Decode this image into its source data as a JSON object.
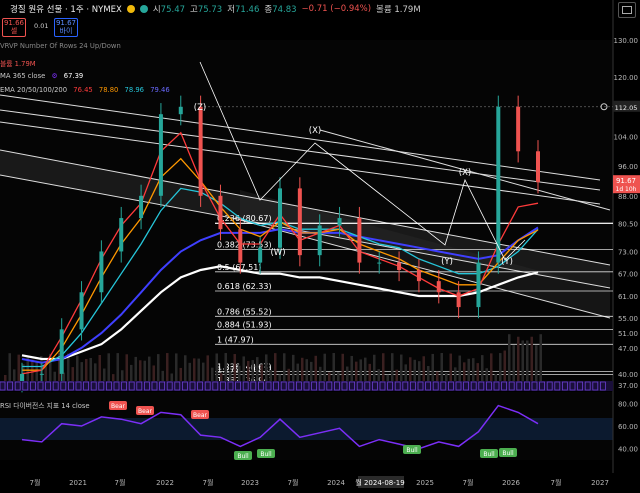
{
  "header": {
    "symbol": "경질 원유 선물 · 1주 · NYMEX",
    "d_badge": "D",
    "open_label": "시",
    "open": "75.47",
    "high_label": "고",
    "high": "75.73",
    "low_label": "저",
    "low": "71.46",
    "close_label": "종",
    "close": "74.83",
    "change": "−0.71 (−0.94%)",
    "volume": "볼륨 1.79M"
  },
  "order": {
    "sell_price": "91.66",
    "sell_label": "셀",
    "spread": "0.01",
    "buy_price": "91.67",
    "buy_label": "바이"
  },
  "indicators": {
    "vrvp": "VRVP Number Of Rows 24 Up/Down",
    "volume": "볼륨 1.79M",
    "ma_name": "MA 365 close",
    "ma_value": "67.39",
    "ema_name": "EMA 20/50/100/200",
    "ema_values": [
      "76.45",
      "78.80",
      "78.96",
      "79.46"
    ],
    "rsi_name": "RSI 다이버전스 지표 14 close"
  },
  "colors": {
    "up": "#26a69a",
    "down": "#ef5350",
    "ma365": "#ffffff",
    "ema20": "#ff3b3b",
    "ema50": "#ff9800",
    "ema100": "#26c6da",
    "ema200": "#3f3fff",
    "rsi": "#7b2ff7",
    "bear": "#ef5350",
    "bull": "#4caf50",
    "fib": "#ffffff"
  },
  "price_badge": {
    "price": "91.67",
    "countdown": "1d 10h"
  },
  "last_close_marker": "112.05",
  "price_axis": [
    "130.00",
    "120.00",
    "112.00",
    "104.00",
    "96.00",
    "88.00",
    "80.50",
    "73.00",
    "67.00",
    "61.00",
    "55.00",
    "51.00",
    "47.00",
    "40.00",
    "37.00"
  ],
  "rsi_axis": [
    "80.00",
    "60.00",
    "40.00"
  ],
  "time_axis": [
    "7월",
    "2021",
    "7월",
    "2022",
    "7월",
    "2023",
    "7월",
    "2024",
    "2024-08-19",
    "2025",
    "7월",
    "2026",
    "7월",
    "2027"
  ],
  "time_axis_highlight": "월 2024-08-19",
  "fib_labels": [
    "0.236 (80.67)",
    "0.382 (73.53)",
    "0.5 (67.51)",
    "0.618 (62.33)",
    "0.786 (55.52)",
    "0.884 (51.93)",
    "1 (47.97)",
    "1.236 (40.67)",
    "1.272 (39.83)",
    "1.382 (36.94)"
  ],
  "wave_labels": [
    "(W)",
    "(X)",
    "(Y)",
    "(X)",
    "(Y)",
    "(Z)"
  ],
  "rsi_badges": [
    "Bear",
    "Bear",
    "Bear",
    "Bull",
    "Bull",
    "Bull",
    "Bull",
    "Bull"
  ],
  "chart_data": {
    "type": "candlestick",
    "title": "",
    "x": [
      "2020-07",
      "2020-10",
      "2021-01",
      "2021-04",
      "2021-07",
      "2021-10",
      "2022-01",
      "2022-03",
      "2022-06",
      "2022-09",
      "2022-12",
      "2023-03",
      "2023-06",
      "2023-09",
      "2023-12",
      "2024-03",
      "2024-06",
      "2024-09",
      "2024-12",
      "2025-03",
      "2025-06",
      "2025-09",
      "2025-12",
      "2026-02",
      "2026-03",
      "2026-04",
      "2026-05"
    ],
    "close": [
      40,
      40,
      52,
      62,
      73,
      82,
      88,
      110,
      112,
      88,
      79,
      70,
      74,
      90,
      72,
      80,
      82,
      70,
      70,
      68,
      65,
      62,
      58,
      70,
      112,
      100,
      91.67
    ],
    "ema20": [
      40,
      41,
      50,
      60,
      71,
      80,
      86,
      100,
      105,
      92,
      82,
      75,
      75,
      83,
      76,
      78,
      80,
      73,
      71,
      69,
      66,
      63,
      61,
      63,
      75,
      85,
      86
    ],
    "ema50": [
      41,
      41,
      47,
      56,
      66,
      75,
      82,
      93,
      98,
      92,
      85,
      79,
      77,
      81,
      78,
      78,
      79,
      75,
      73,
      71,
      68,
      66,
      64,
      64,
      70,
      76,
      78.8
    ],
    "ema100": [
      42,
      42,
      45,
      51,
      59,
      67,
      75,
      84,
      90,
      89,
      86,
      82,
      80,
      81,
      79,
      79,
      79,
      77,
      75,
      74,
      71,
      69,
      67,
      67,
      69,
      73,
      78.96
    ],
    "ema200": [
      44,
      43,
      44,
      47,
      51,
      56,
      62,
      68,
      73,
      76,
      78,
      78,
      78,
      79,
      78,
      78,
      78,
      77,
      76,
      75,
      74,
      73,
      72,
      71,
      72,
      76,
      79.46
    ],
    "ma365": [
      45,
      44,
      44,
      46,
      48,
      52,
      57,
      62,
      66,
      68,
      69,
      68,
      67,
      67,
      66,
      66,
      65,
      64,
      63,
      62,
      61,
      61,
      61,
      62,
      64,
      66,
      67.39
    ],
    "rsi": [
      48,
      46,
      62,
      60,
      68,
      66,
      62,
      72,
      70,
      52,
      50,
      42,
      50,
      66,
      50,
      54,
      58,
      42,
      48,
      44,
      40,
      46,
      42,
      55,
      78,
      72,
      62
    ],
    "ylim": [
      37,
      130
    ],
    "rsi_ylim": [
      30,
      90
    ],
    "fib_levels": [
      80.67,
      73.53,
      67.51,
      62.33,
      55.52,
      51.93,
      47.97,
      40.67,
      39.83,
      36.94
    ],
    "ylabel": "",
    "xlabel": ""
  }
}
